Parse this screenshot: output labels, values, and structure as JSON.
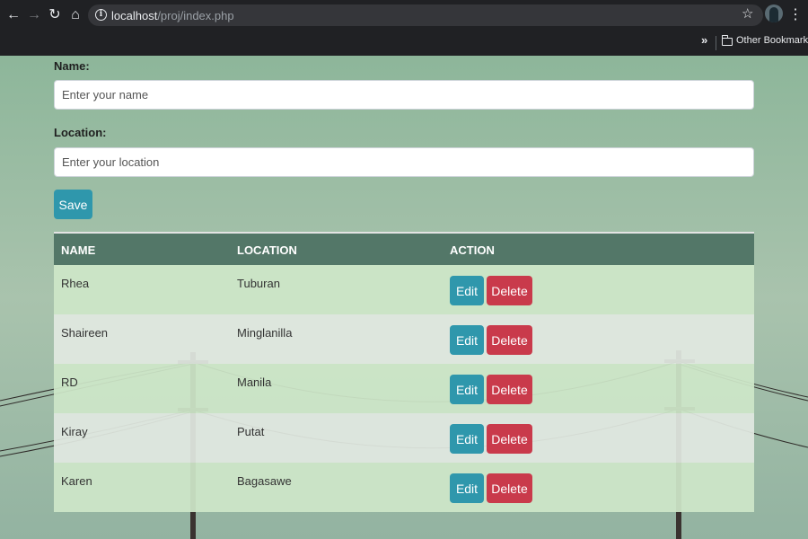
{
  "browser": {
    "url_host": "localhost",
    "url_path": "/proj/index.php",
    "bookmarks_overflow": "»",
    "bookmarks_folder": "Other Bookmarks"
  },
  "form": {
    "name_label": "Name:",
    "name_placeholder": "Enter your name",
    "location_label": "Location:",
    "location_placeholder": "Enter your location",
    "save_label": "Save"
  },
  "table": {
    "headers": [
      "NAME",
      "LOCATION",
      "ACTION"
    ],
    "edit_label": "Edit",
    "delete_label": "Delete",
    "rows": [
      {
        "name": "Rhea",
        "location": "Tuburan"
      },
      {
        "name": "Shaireen",
        "location": "Minglanilla"
      },
      {
        "name": "RD",
        "location": "Manila"
      },
      {
        "name": "Kiray",
        "location": "Putat"
      },
      {
        "name": "Karen",
        "location": "Bagasawe"
      }
    ]
  },
  "colors": {
    "primary": "#2f97ac",
    "danger": "#c93a4b",
    "table_header": "#537768",
    "background": "#8fb59b"
  },
  "icons": [
    "back-arrow-icon",
    "forward-arrow-icon",
    "reload-icon",
    "home-icon",
    "info-icon",
    "star-icon",
    "menu-icon",
    "folder-icon"
  ]
}
